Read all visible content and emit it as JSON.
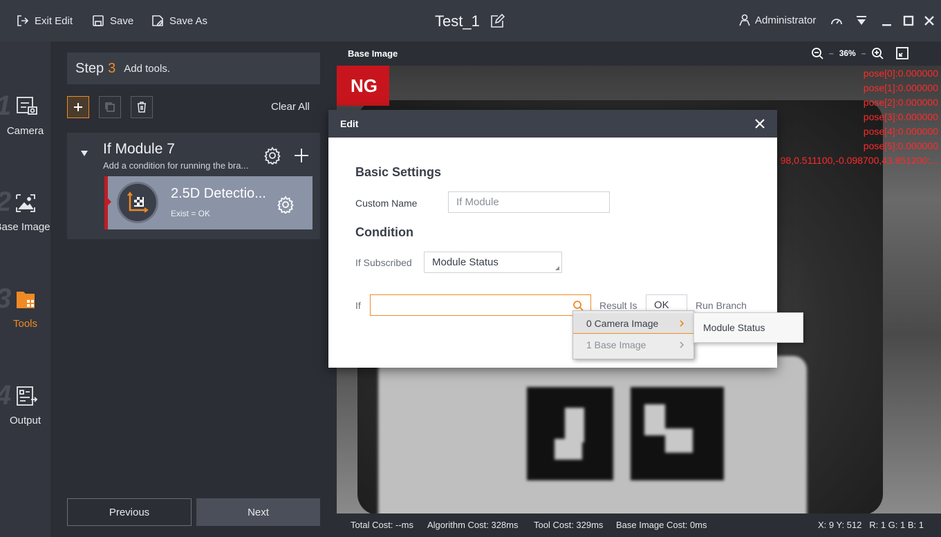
{
  "titlebar": {
    "exit_edit": "Exit Edit",
    "save": "Save",
    "save_as": "Save As",
    "doc_title": "Test_1",
    "user": "Administrator"
  },
  "leftnav": {
    "items": [
      {
        "label": "Camera",
        "step": "1"
      },
      {
        "label": "Base Image",
        "step": "2"
      },
      {
        "label": "Tools",
        "step": "3"
      },
      {
        "label": "Output",
        "step": "4"
      }
    ],
    "active": "Tools",
    "accent": "#f08a24"
  },
  "panel": {
    "step_word": "Step",
    "step_num": "3",
    "step_text": "Add tools.",
    "clear_all": "Clear All",
    "module": {
      "title": "If Module 7",
      "subtitle": "Add a condition for running the bra...",
      "tool_name": "2.5D Detectio...",
      "tool_status": "Exist = OK"
    },
    "prev": "Previous",
    "next": "Next"
  },
  "image": {
    "title": "Base Image",
    "zoom": "36%",
    "ng": "NG",
    "pose_lines": [
      "pose[0]:0.000000",
      "pose[1]:0.000000",
      "pose[2]:0.000000",
      "pose[3]:0.000000",
      "pose[4]:0.000000",
      "pose[5]:0.000000",
      "98,0.511100,-0.098700,43.851200;..."
    ],
    "status": {
      "total": "Total Cost: --ms",
      "algo": "Algorithm Cost: 328ms",
      "tool": "Tool Cost: 329ms",
      "base": "Base Image Cost: 0ms",
      "coords": "X: 9 Y: 512   R: 1 G: 1 B: 1"
    }
  },
  "dialog": {
    "title": "Edit",
    "basic_settings": "Basic Settings",
    "custom_name_label": "Custom Name",
    "custom_name_placeholder": "If Module",
    "condition": "Condition",
    "if_subscribed_label": "If Subscribed",
    "if_subscribed_value": "Module Status",
    "if_label": "If",
    "if_value": "",
    "result_is_label": "Result Is",
    "result_value": "OK",
    "run_branch": "Run Branch"
  },
  "menu": {
    "items": [
      "0 Camera Image",
      "1 Base Image"
    ],
    "submenu": [
      "Module Status"
    ]
  }
}
